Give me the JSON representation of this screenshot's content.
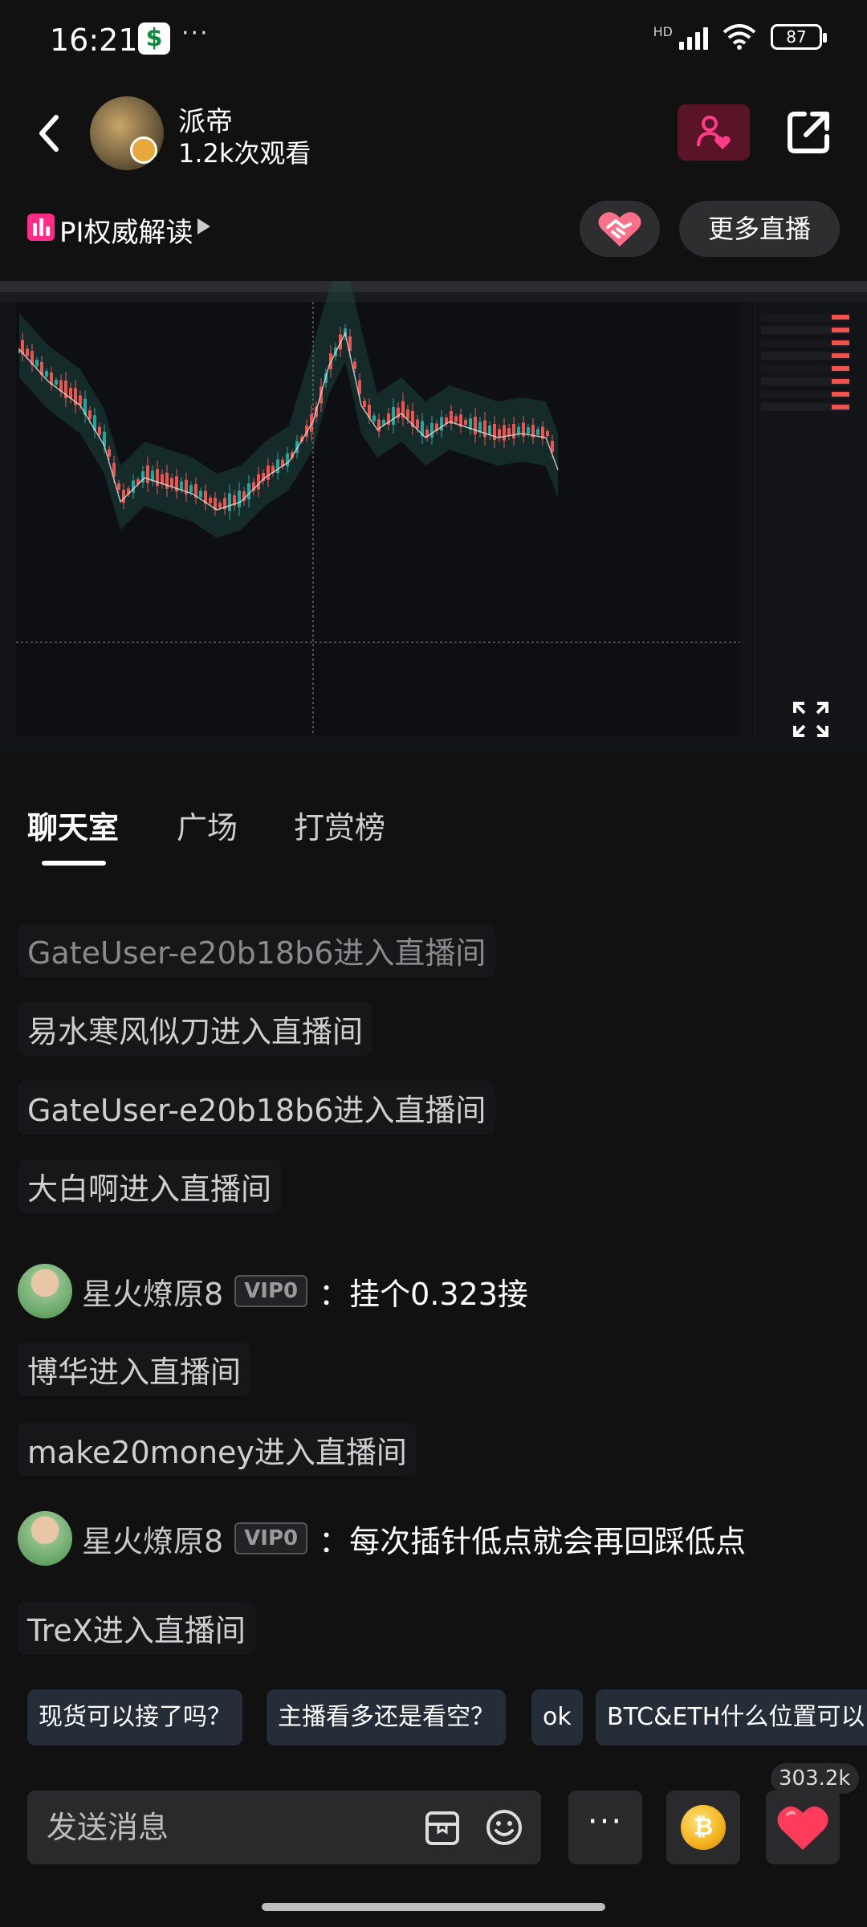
{
  "status_bar": {
    "time": "16:21",
    "dots": "···",
    "network": "HD",
    "battery": "87"
  },
  "header": {
    "host_name": "派帝",
    "views": "1.2k次观看"
  },
  "subheader": {
    "topic": "PI权威解读",
    "more_live": "更多直播"
  },
  "tabs": [
    {
      "label": "聊天室"
    },
    {
      "label": "广场"
    },
    {
      "label": "打赏榜"
    }
  ],
  "chat": {
    "messages": [
      {
        "text": "GateUser-e20b18b6进入直播间"
      },
      {
        "text": "易水寒风似刀进入直播间"
      },
      {
        "text": "GateUser-e20b18b6进入直播间"
      },
      {
        "text": "大白啊进入直播间"
      },
      {
        "user": "星火燎原8",
        "vip": "VIP0",
        "text": "：挂个0.323接"
      },
      {
        "text": "博华进入直播间"
      },
      {
        "text": "make20money进入直播间"
      },
      {
        "user": "星火燎原8",
        "vip": "VIP0",
        "text": "：每次插针低点就会再回踩低点"
      },
      {
        "text": "TreX进入直播间"
      }
    ]
  },
  "quick_replies": [
    "现货可以接了吗？",
    "主播看多还是看空？",
    "ok",
    "BTC&ETH什么位置可以"
  ],
  "like_count": "303.2k",
  "input": {
    "placeholder": "发送消息"
  },
  "colors": {
    "background": "#111112",
    "up_candle": "#26a69a",
    "down_candle": "#ef5350",
    "follow_btn": "#5a1428",
    "heart": "#ff3b5c"
  },
  "icons": [
    "back-arrow-icon",
    "follow-heart-icon",
    "share-icon",
    "handshake-icon",
    "fullscreen-icon",
    "sticker-icon",
    "emoji-icon",
    "coin-icon",
    "heart-icon"
  ]
}
